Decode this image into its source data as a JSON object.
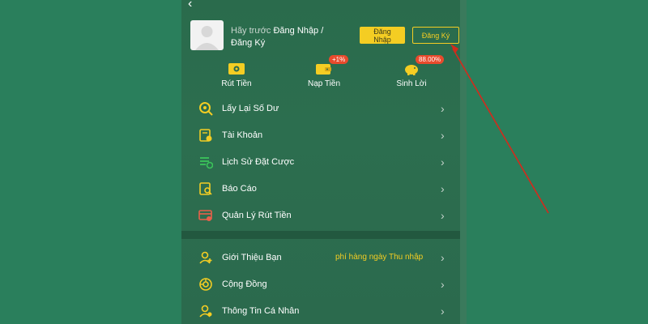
{
  "header": {
    "back_icon": "chevron-left-icon",
    "prompt_prefix": "Hãy trước",
    "prompt_login": "Đăng Nhập /",
    "prompt_register": "Đăng Ký",
    "login_button": "Đăng Nhập",
    "register_button": "Đăng Ký"
  },
  "quick_actions": [
    {
      "label": "Rút Tiền",
      "icon": "withdraw-ticket-icon"
    },
    {
      "label": "Nạp Tiền",
      "icon": "wallet-icon",
      "badge": "+1%"
    },
    {
      "label": "Sinh Lời",
      "icon": "piggy-bank-icon",
      "badge": "88.00%"
    }
  ],
  "menu_group_1": [
    {
      "label": "Lấy Lại Số Dư",
      "icon": "search-coin-icon"
    },
    {
      "label": "Tài Khoản",
      "icon": "account-card-icon"
    },
    {
      "label": "Lịch Sử Đặt Cược",
      "icon": "bet-history-icon"
    },
    {
      "label": "Báo Cáo",
      "icon": "report-icon"
    },
    {
      "label": "Quản Lý Rút Tiền",
      "icon": "withdraw-manage-icon"
    }
  ],
  "menu_group_2": [
    {
      "label": "Giới Thiệu Bạn",
      "icon": "invite-friend-icon",
      "extra": "phí hàng ngày  Thu nhập"
    },
    {
      "label": "Cộng Đồng",
      "icon": "community-icon"
    },
    {
      "label": "Thông Tin Cá Nhân",
      "icon": "profile-icon"
    }
  ],
  "colors": {
    "accent": "#f4cd23",
    "badge": "#e84a2c",
    "annotation_arrow": "#d42a1c"
  }
}
